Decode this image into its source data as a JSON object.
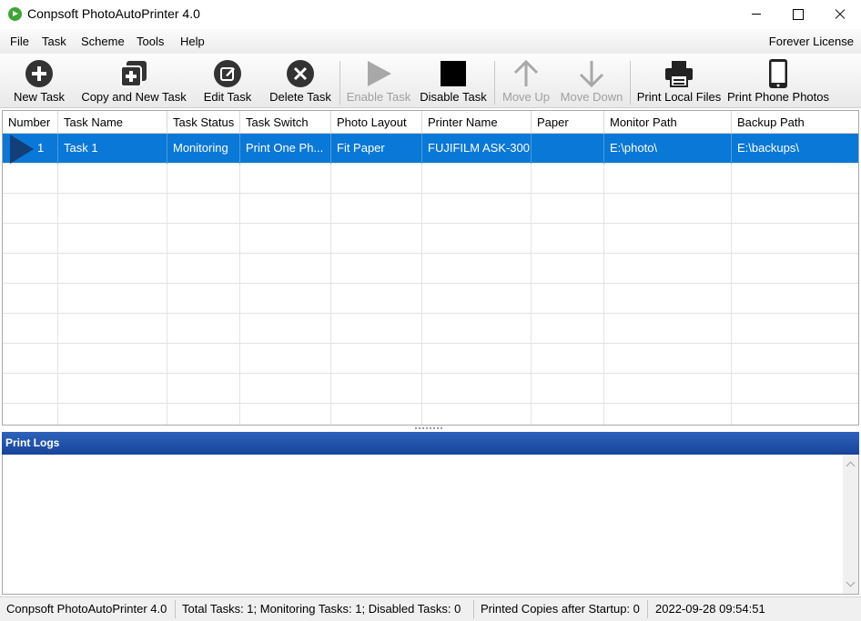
{
  "window": {
    "title": "Conpsoft PhotoAutoPrinter 4.0",
    "controls": [
      "minimize",
      "maximize",
      "close"
    ]
  },
  "menu": {
    "items": [
      "File",
      "Task",
      "Scheme",
      "Tools",
      "Help"
    ],
    "license": "Forever License"
  },
  "toolbar": {
    "buttons": [
      {
        "label": "New Task",
        "icon": "plus-circle-icon",
        "enabled": true
      },
      {
        "label": "Copy and New Task",
        "icon": "copy-plus-icon",
        "enabled": true
      },
      {
        "label": "Edit Task",
        "icon": "edit-icon",
        "enabled": true
      },
      {
        "label": "Delete Task",
        "icon": "delete-x-icon",
        "enabled": true
      },
      {
        "label": "Enable Task",
        "icon": "play-icon",
        "enabled": false
      },
      {
        "label": "Disable Task",
        "icon": "stop-icon",
        "enabled": true
      },
      {
        "label": "Move Up",
        "icon": "arrow-up-icon",
        "enabled": false
      },
      {
        "label": "Move Down",
        "icon": "arrow-down-icon",
        "enabled": false
      },
      {
        "label": "Print Local Files",
        "icon": "printer-icon",
        "enabled": true
      },
      {
        "label": "Print Phone Photos",
        "icon": "phone-icon",
        "enabled": true
      }
    ]
  },
  "task_grid": {
    "columns": [
      "Number",
      "Task Name",
      "Task Status",
      "Task Switch",
      "Photo Layout",
      "Printer Name",
      "Paper",
      "Monitor Path",
      "Backup Path"
    ],
    "rows": [
      {
        "number": "1",
        "task_name": "Task 1",
        "task_status": "Monitoring",
        "task_switch": "Print One Ph...",
        "photo_layout": "Fit Paper",
        "printer_name": "FUJIFILM ASK-300",
        "paper": "",
        "monitor_path": "E:\\photo\\",
        "backup_path": "E:\\backups\\",
        "selected": true
      }
    ]
  },
  "print_logs": {
    "title": "Print Logs",
    "entries": []
  },
  "statusbar": {
    "app": "Conpsoft PhotoAutoPrinter 4.0",
    "tasks": "Total Tasks: 1; Monitoring Tasks: 1; Disabled Tasks: 0",
    "copies": "Printed Copies after Startup: 0",
    "datetime": "2022-09-28 09:54:51"
  },
  "colors": {
    "selection": "#0a78d7",
    "logs_header": "#1f52a8",
    "row_arrow": "#123f78",
    "app_icon": "#3fa535"
  }
}
